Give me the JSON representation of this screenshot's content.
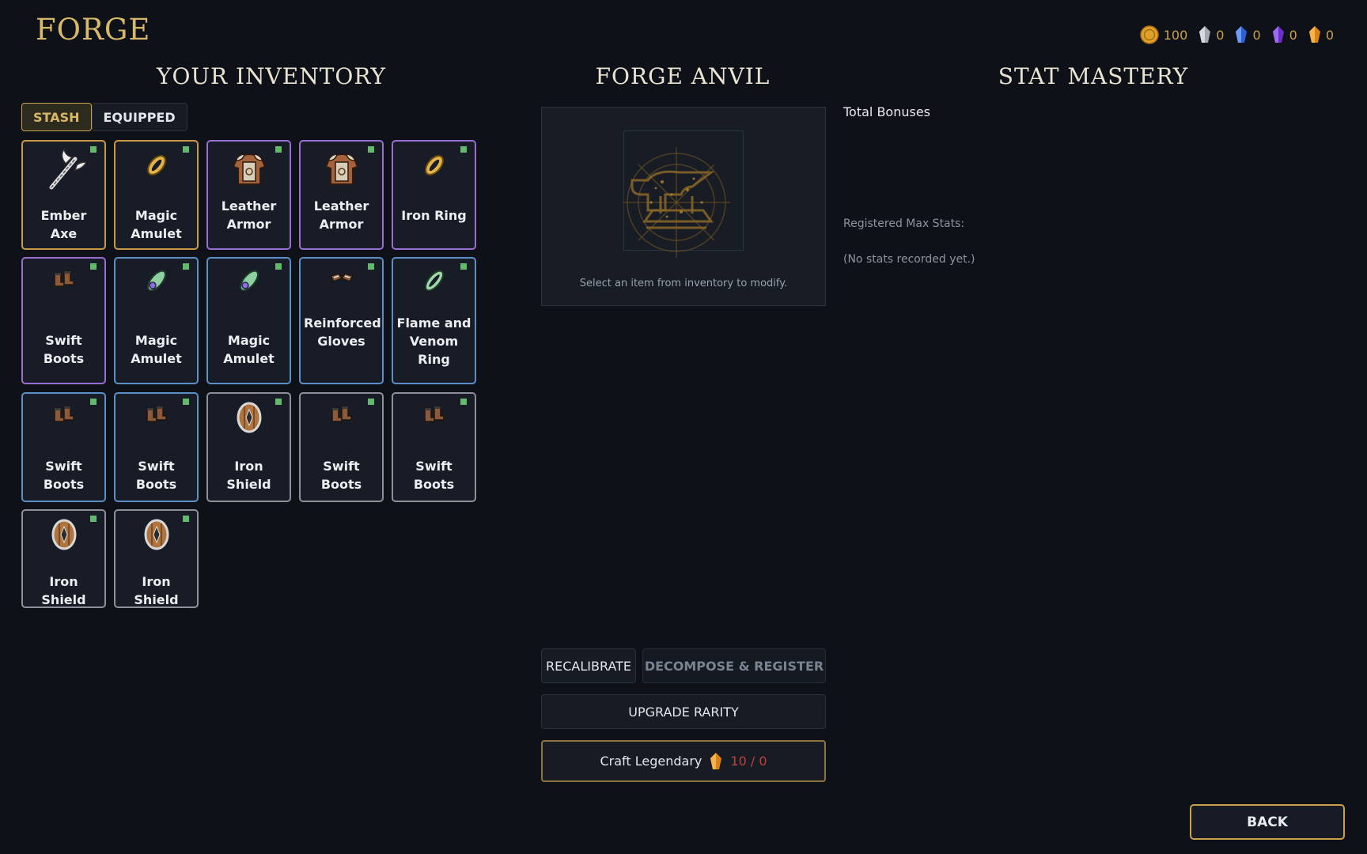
{
  "header": {
    "title": "FORGE"
  },
  "currencies": [
    {
      "name": "gold",
      "icon": "gold-coin-icon",
      "value": "100",
      "color": "#e0a12a"
    },
    {
      "name": "silver",
      "icon": "silver-crystal-icon",
      "value": "0",
      "color": "#9aa0a8"
    },
    {
      "name": "blue",
      "icon": "blue-crystal-icon",
      "value": "0",
      "color": "#3b6de0"
    },
    {
      "name": "purple",
      "icon": "purple-crystal-icon",
      "value": "0",
      "color": "#7a3fd6"
    },
    {
      "name": "orange",
      "icon": "orange-crystal-icon",
      "value": "0",
      "color": "#e0901f"
    }
  ],
  "inventory": {
    "title": "YOUR INVENTORY",
    "tabs": [
      {
        "label": "STASH",
        "active": true
      },
      {
        "label": "EQUIPPED",
        "active": false
      }
    ],
    "items": [
      {
        "name": "Ember Axe",
        "rarity": "legendary",
        "icon": "axe-icon"
      },
      {
        "name": "Magic Amulet",
        "rarity": "legendary",
        "icon": "gold-ring-icon"
      },
      {
        "name": "Leather Armor",
        "rarity": "epic",
        "icon": "armor-icon"
      },
      {
        "name": "Leather Armor",
        "rarity": "epic",
        "icon": "armor-icon"
      },
      {
        "name": "Iron Ring",
        "rarity": "epic",
        "icon": "gold-ring-icon"
      },
      {
        "name": "Swift Boots",
        "rarity": "epic",
        "icon": "boots-icon"
      },
      {
        "name": "Magic Amulet",
        "rarity": "rare",
        "icon": "amulet-icon"
      },
      {
        "name": "Magic Amulet",
        "rarity": "rare",
        "icon": "amulet-icon"
      },
      {
        "name": "Reinforced Gloves",
        "rarity": "rare",
        "icon": "gloves-icon"
      },
      {
        "name": "Flame and Venom Ring",
        "rarity": "rare",
        "icon": "green-ring-icon"
      },
      {
        "name": "Swift Boots",
        "rarity": "rare",
        "icon": "boots-icon"
      },
      {
        "name": "Swift Boots",
        "rarity": "rare",
        "icon": "boots-icon"
      },
      {
        "name": "Iron Shield",
        "rarity": "common",
        "icon": "shield-icon"
      },
      {
        "name": "Swift Boots",
        "rarity": "common",
        "icon": "boots-icon"
      },
      {
        "name": "Swift Boots",
        "rarity": "common",
        "icon": "boots-icon"
      },
      {
        "name": "Iron Shield",
        "rarity": "common",
        "icon": "shield-icon"
      },
      {
        "name": "Iron Shield",
        "rarity": "common",
        "icon": "shield-icon"
      }
    ]
  },
  "anvil": {
    "title": "FORGE ANVIL",
    "hint": "Select an item from inventory to modify.",
    "recalibrate_label": "RECALIBRATE",
    "decompose_label": "DECOMPOSE & REGISTER",
    "upgrade_label": "UPGRADE RARITY",
    "craft_label": "Craft Legendary",
    "craft_cost": "10 / 0",
    "craft_cost_icon": "orange-crystal-icon"
  },
  "mastery": {
    "title": "STAT MASTERY",
    "total_bonuses": "Total Bonuses",
    "registered_label": "Registered Max Stats:",
    "empty_text": "(No stats recorded yet.)"
  },
  "footer": {
    "back_label": "BACK"
  }
}
